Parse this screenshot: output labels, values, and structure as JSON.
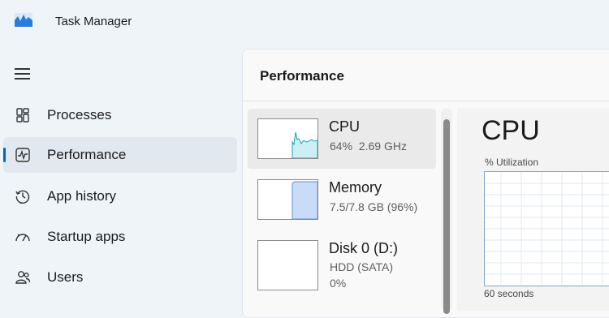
{
  "window": {
    "title": "Task Manager"
  },
  "nav": {
    "items": [
      {
        "label": "Processes",
        "icon": "processes-icon",
        "active": false
      },
      {
        "label": "Performance",
        "icon": "performance-icon",
        "active": true
      },
      {
        "label": "App history",
        "icon": "history-icon",
        "active": false
      },
      {
        "label": "Startup apps",
        "icon": "speedometer-icon",
        "active": false
      },
      {
        "label": "Users",
        "icon": "users-icon",
        "active": false
      }
    ]
  },
  "panel": {
    "title": "Performance"
  },
  "cards": [
    {
      "title": "CPU",
      "line1": "64%",
      "line2": "2.69 GHz",
      "selected": true,
      "color": "#17a2b8"
    },
    {
      "title": "Memory",
      "line1": "7.5/7.8 GB (96%)",
      "selected": false,
      "color": "#5b8fd9"
    },
    {
      "title": "Disk 0 (D:)",
      "line1": "HDD (SATA)",
      "line2": "0%",
      "selected": false,
      "color": "#4caf50"
    }
  ],
  "detail": {
    "title": "CPU",
    "graph_label": "% Utilization",
    "time_label": "60 seconds"
  },
  "colors": {
    "accent": "#0067c0",
    "cpu": "#17a2b8",
    "memory": "#5b8fd9"
  }
}
